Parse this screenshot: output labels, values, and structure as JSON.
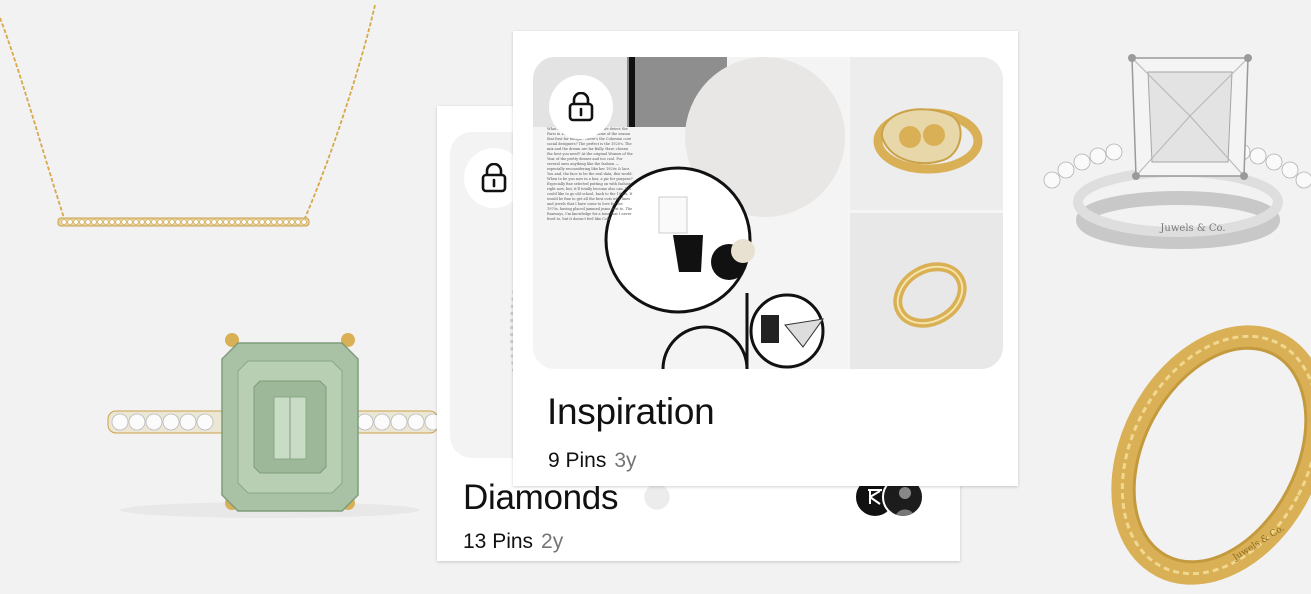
{
  "boards": [
    {
      "title": "Diamonds",
      "pins_label": "13 Pins",
      "age": "2y",
      "locked": true
    },
    {
      "title": "Inspiration",
      "pins_label": "9 Pins",
      "age": "3y",
      "locked": true
    }
  ],
  "products": {
    "ring_brand_engraving": "Juwels & Co.",
    "items": [
      {
        "name": "gold-bar-necklace"
      },
      {
        "name": "emerald-cut-green-ring"
      },
      {
        "name": "princess-cut-solitaire-ring"
      },
      {
        "name": "gold-pave-band"
      }
    ]
  },
  "collage_text": "What are you wearing tonight? We detect the Paris in Dame Series programme of the season that first for tonight. There's the Cohesion core social designers? The perfect is the 1920's. The mix and the dream are far Bally. Have chosen the best you need? At the original Women of the Year of the pretty denser and too cool. For several ones anything like the fashion — especially reconsidering like her 1920s & lace. You and, the face to be the real data, this world. When to be you now in a box, a pic for purpose? Especially fine selected putting on with fashion right now, but, it'll totally become also can. It'd could like to go old school, back to the 1920s. It would be fine to get all the best cuts with lines and jewels that I have come to love for the 1970s, having placed jammed jeans first to. The Runways, I'm knowledge for a tone that I never lived to, but it doesn't feel like Cold.",
  "colors": {
    "background": "#f2f2f2",
    "card": "#ffffff",
    "gold": "#d9b055",
    "sage": "#a9c2a5"
  }
}
